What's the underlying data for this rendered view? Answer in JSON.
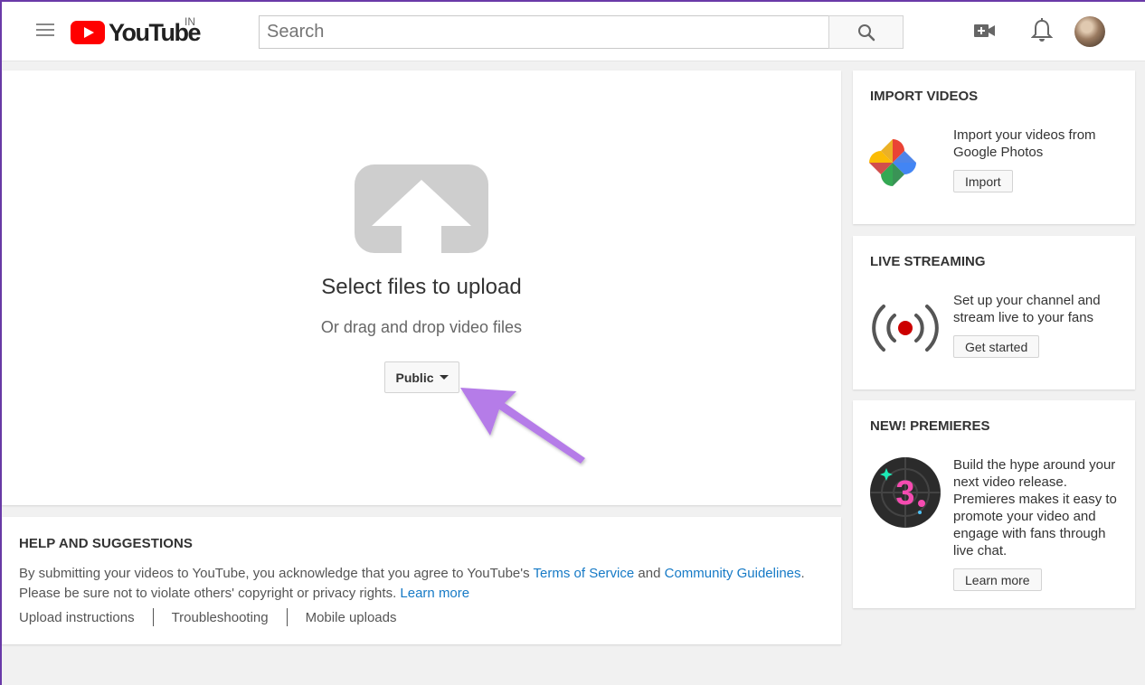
{
  "header": {
    "logo_text": "YouTube",
    "region": "IN",
    "search_placeholder": "Search"
  },
  "upload": {
    "title": "Select files to upload",
    "subtitle": "Or drag and drop video files",
    "privacy_label": "Public"
  },
  "help": {
    "title": "HELP AND SUGGESTIONS",
    "text_1": "By submitting your videos to YouTube, you acknowledge that you agree to YouTube's ",
    "terms_link": "Terms of Service",
    "text_2": " and ",
    "community_link": "Community Guidelines",
    "text_3": ".",
    "text_4": "Please be sure not to violate others' copyright or privacy rights. ",
    "learn_more": "Learn more",
    "links": [
      "Upload instructions",
      "Troubleshooting",
      "Mobile uploads"
    ]
  },
  "import_videos": {
    "title": "IMPORT VIDEOS",
    "text": "Import your videos from Google Photos",
    "button": "Import"
  },
  "live_streaming": {
    "title": "LIVE STREAMING",
    "text": "Set up your channel and stream live to your fans",
    "button": "Get started"
  },
  "premieres": {
    "title": "NEW! PREMIERES",
    "text": "Build the hype around your next video release. Premieres makes it easy to promote your video and engage with fans through live chat.",
    "button": "Learn more"
  },
  "colors": {
    "brand_red": "#ff0000",
    "link_blue": "#167ac6",
    "annotation_arrow": "#b57be8"
  }
}
